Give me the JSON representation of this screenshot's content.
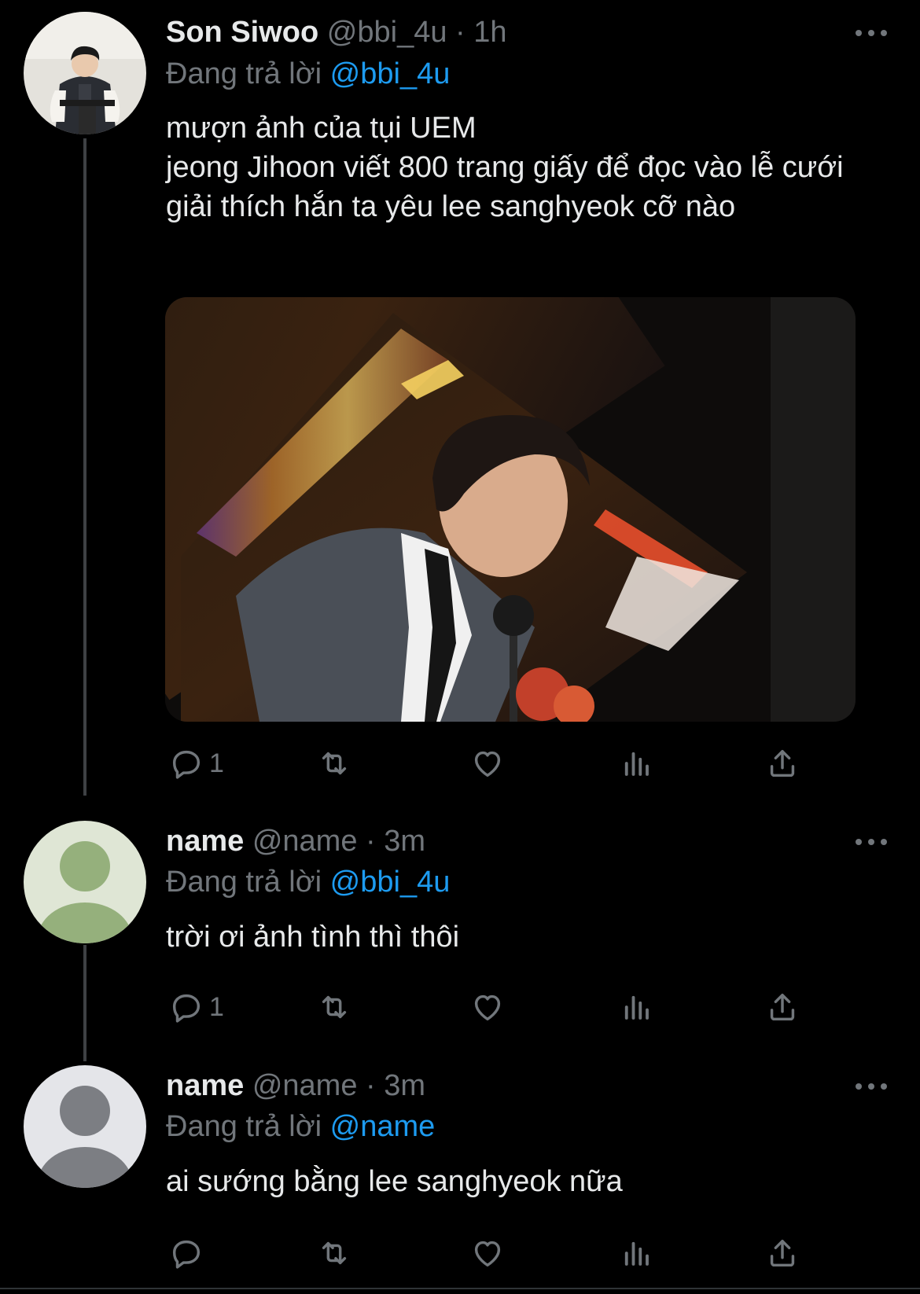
{
  "tweets": [
    {
      "display_name": "Son Siwoo",
      "handle": "@bbi_4u",
      "time": "1h",
      "reply_prefix": "Đang trả lời",
      "reply_to": "@bbi_4u",
      "text": "mượn ảnh của tụi UEM\njeong Jihoon viết 800 trang giấy để đọc vào lễ cưới giải thích hắn ta yêu lee sanghyeok cỡ nào",
      "reply_count": "1",
      "avatar_icon": "user-photo-avatar",
      "has_media": true
    },
    {
      "display_name": "name",
      "handle": "@name",
      "time": "3m",
      "reply_prefix": "Đang trả lời",
      "reply_to": "@bbi_4u",
      "text": "trời ơi ảnh tình thì thôi",
      "reply_count": "1",
      "avatar_icon": "default-user-avatar-green"
    },
    {
      "display_name": "name",
      "handle": "@name",
      "time": "3m",
      "reply_prefix": "Đang trả lời",
      "reply_to": "@name",
      "text": "ai sướng bằng lee sanghyeok nữa",
      "reply_count": "",
      "avatar_icon": "default-user-avatar-gray"
    }
  ],
  "separator": "·",
  "icons": [
    "reply-icon",
    "retweet-icon",
    "like-icon",
    "views-icon",
    "share-icon",
    "more-icon"
  ],
  "colors": {
    "background": "#000000",
    "text": "#e7e9ea",
    "secondary": "#71767b",
    "link": "#1d9bf0",
    "thread_line": "#3e4144"
  }
}
